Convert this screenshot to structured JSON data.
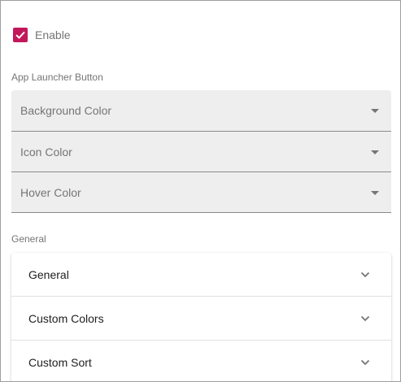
{
  "enable": {
    "label": "Enable",
    "checked": true,
    "accent_color": "#c2185b"
  },
  "app_launcher": {
    "section_label": "App Launcher Button",
    "fields": [
      {
        "label": "Background Color"
      },
      {
        "label": "Icon Color"
      },
      {
        "label": "Hover Color"
      }
    ]
  },
  "general": {
    "section_label": "General",
    "panels": [
      {
        "label": "General",
        "icon": "chevron-down-icon"
      },
      {
        "label": "Custom Colors",
        "icon": "chevron-down-icon"
      },
      {
        "label": "Custom Sort",
        "icon": "chevron-down-icon"
      }
    ]
  }
}
